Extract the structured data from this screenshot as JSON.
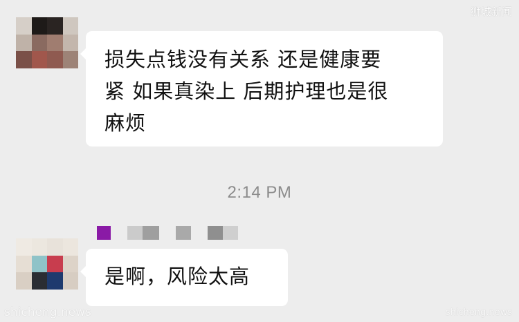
{
  "watermarks": {
    "top_right": "狮城新闻",
    "bottom_left": "shicheng.news",
    "bottom_right": "shicheng.news"
  },
  "messages": [
    {
      "lines": [
        "损失点钱没有关系 还是健康要",
        "紧 如果真染上 后期护理也是很",
        "麻烦"
      ]
    },
    {
      "lines": [
        "是啊，风险太高"
      ]
    }
  ],
  "timestamp": "2:14 PM",
  "colors": {
    "background": "#ededed",
    "bubble": "#ffffff",
    "text": "#111111",
    "timestamp": "#8c8c8c"
  }
}
